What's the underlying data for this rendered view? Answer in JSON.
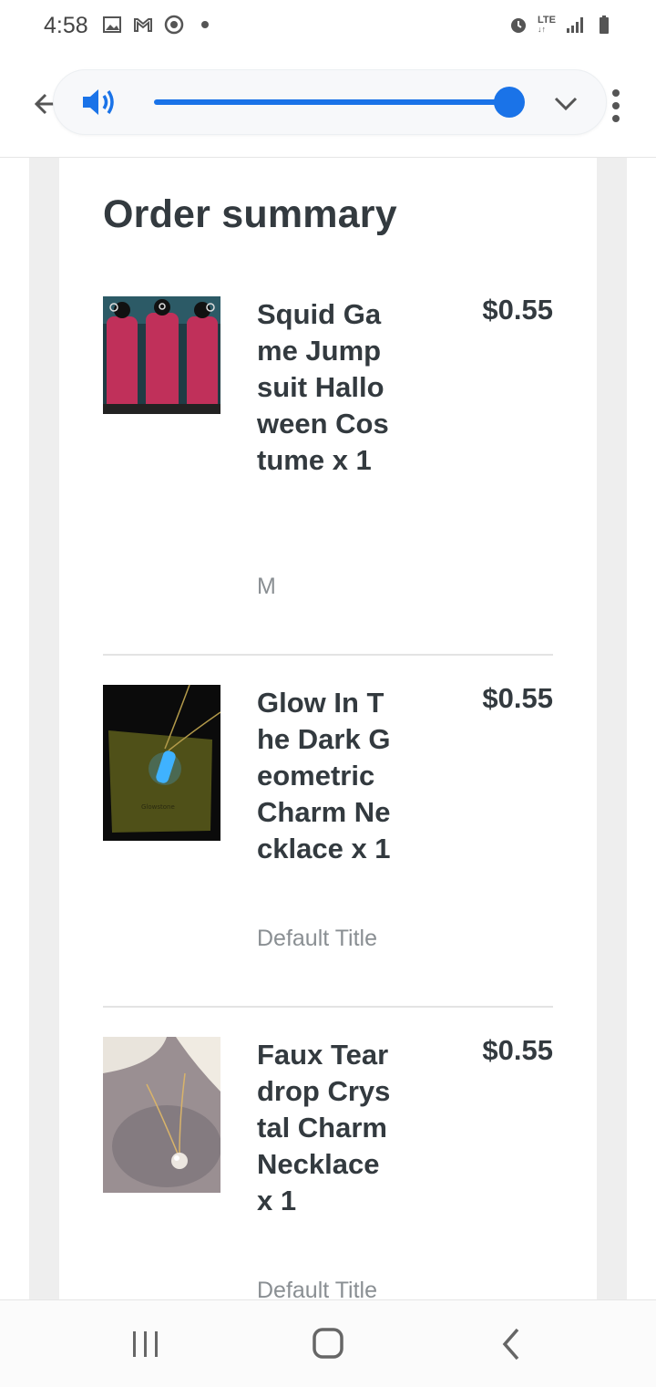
{
  "status_bar": {
    "time": "4:58",
    "left_icons": [
      "image-icon",
      "gmail-icon",
      "chrome-icon",
      "dot-icon"
    ],
    "right_icons": [
      "alarm-icon",
      "lte-icon",
      "signal-icon",
      "battery-icon"
    ],
    "network_label": "LTE"
  },
  "toolbar": {
    "volume_level": 1.0,
    "accent_color": "#1a73e8"
  },
  "order": {
    "title": "Order summary",
    "items": [
      {
        "name": "Squid Game Jumpsuit Halloween Costume",
        "qty": "x 1",
        "variant": "M",
        "price": "$0.55"
      },
      {
        "name": "Glow In The Dark Geometric Charm Necklace",
        "qty": "x 1",
        "variant": "Default Title",
        "price": "$0.55"
      },
      {
        "name": "Faux Teardrop Crystal Charm Necklace",
        "qty": "x 1",
        "variant": "Default Title",
        "price": "$0.55"
      }
    ]
  },
  "nav": {
    "buttons": [
      "recents-icon",
      "home-icon",
      "back-icon"
    ]
  }
}
